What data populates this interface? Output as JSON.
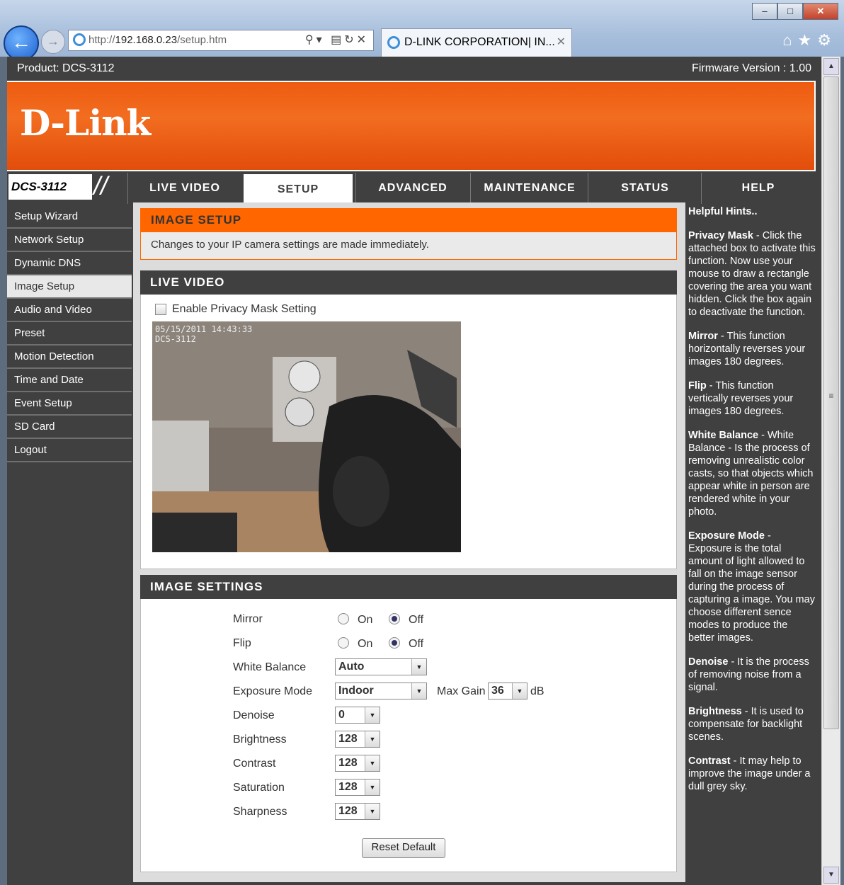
{
  "browser": {
    "window_buttons": [
      "–",
      "□",
      "✕"
    ],
    "url_host": "http://",
    "url_ip": "192.168.0.23",
    "url_path": "/setup.htm",
    "tab_title": "D-LINK CORPORATION| IN...",
    "tab_close": "✕"
  },
  "header": {
    "product": "Product: DCS-3112",
    "firmware": "Firmware Version : 1.00",
    "logo": "D-Link"
  },
  "model": "DCS-3112",
  "tabs": [
    "LIVE VIDEO",
    "SETUP",
    "ADVANCED",
    "MAINTENANCE",
    "STATUS",
    "HELP"
  ],
  "sidebar": [
    "Setup Wizard",
    "Network Setup",
    "Dynamic DNS",
    "Image Setup",
    "Audio and Video",
    "Preset",
    "Motion Detection",
    "Time and Date",
    "Event Setup",
    "SD Card",
    "Logout"
  ],
  "image_setup": {
    "title": "IMAGE SETUP",
    "desc": "Changes to your IP camera settings are made immediately."
  },
  "live_video": {
    "title": "LIVE VIDEO",
    "privacy_label": "Enable Privacy Mask Setting",
    "osd_line1": "05/15/2011 14:43:33",
    "osd_line2": "DCS-3112"
  },
  "image_settings": {
    "title": "IMAGE SETTINGS",
    "mirror_label": "Mirror",
    "flip_label": "Flip",
    "on": "On",
    "off": "Off",
    "white_balance_label": "White Balance",
    "white_balance": "Auto",
    "exposure_label": "Exposure Mode",
    "exposure": "Indoor",
    "max_gain_label": "Max Gain",
    "max_gain": "36",
    "db": "dB",
    "denoise_label": "Denoise",
    "denoise": "0",
    "brightness_label": "Brightness",
    "brightness": "128",
    "contrast_label": "Contrast",
    "contrast": "128",
    "saturation_label": "Saturation",
    "saturation": "128",
    "sharpness_label": "Sharpness",
    "sharpness": "128",
    "reset_button": "Reset Default"
  },
  "hints": {
    "title": "Helpful Hints..",
    "items": [
      {
        "term": "Privacy Mask",
        "text": " - Click the attached box to activate this function. Now use your mouse to draw a rectangle covering the area you want hidden. Click the box again to deactivate the function."
      },
      {
        "term": "Mirror",
        "text": " - This function horizontally reverses your images 180 degrees."
      },
      {
        "term": "Flip",
        "text": " - This function vertically reverses your images 180 degrees."
      },
      {
        "term": "White Balance",
        "text": " - White Balance - Is the process of removing unrealistic color casts, so that objects which appear white in person are rendered white in your photo."
      },
      {
        "term": "Exposure Mode",
        "text": " - Exposure is the total amount of light allowed to fall on the image sensor during the process of capturing a image. You may choose different sence modes to produce the better images."
      },
      {
        "term": "Denoise",
        "text": " - It is the process of removing noise from a signal."
      },
      {
        "term": "Brightness",
        "text": " - It is used to compensate for backlight scenes."
      },
      {
        "term": "Contrast",
        "text": " - It may help to improve the image under a dull grey sky."
      }
    ]
  },
  "colors": {
    "brand_orange": "#ff6600",
    "dark_gray": "#404040"
  }
}
